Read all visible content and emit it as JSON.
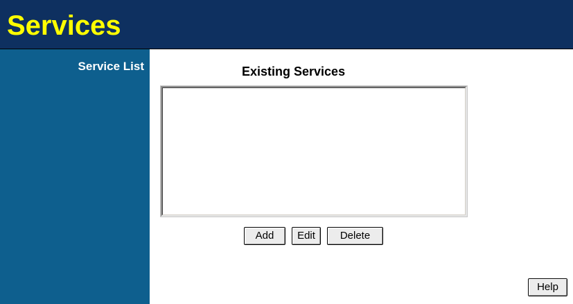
{
  "header": {
    "title": "Services"
  },
  "sidebar": {
    "items": [
      {
        "label": "Service List"
      }
    ]
  },
  "main": {
    "heading": "Existing Services",
    "service_list": {
      "items": []
    },
    "buttons": {
      "add_label": "Add",
      "edit_label": "Edit",
      "delete_label": "Delete",
      "help_label": "Help"
    }
  },
  "colors": {
    "header_bg": "#0e3060",
    "title_color": "#ffff00",
    "sidebar_bg": "#0e5f8e",
    "sidebar_text": "#ffffff",
    "content_bg": "#ffffff"
  }
}
